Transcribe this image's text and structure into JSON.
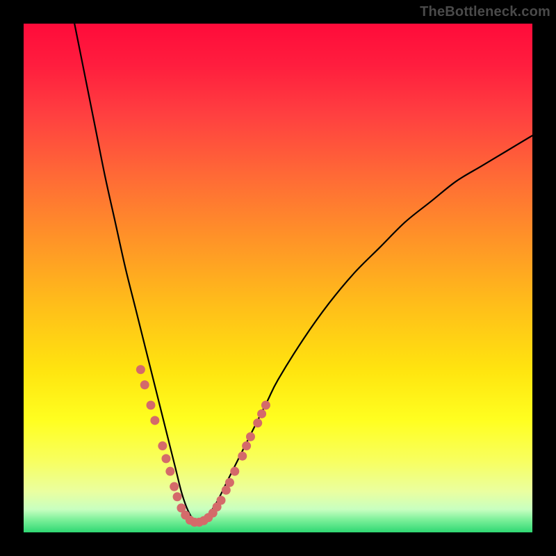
{
  "watermark": "TheBottleneck.com",
  "colors": {
    "frame": "#000000",
    "curve": "#000000",
    "marker": "#d46a6a",
    "bottom_band": "#2fd873",
    "grad_stops": [
      {
        "offset": 0.0,
        "color": "#ff0b3a"
      },
      {
        "offset": 0.08,
        "color": "#ff1d3e"
      },
      {
        "offset": 0.18,
        "color": "#ff4040"
      },
      {
        "offset": 0.3,
        "color": "#ff6a36"
      },
      {
        "offset": 0.42,
        "color": "#ff9228"
      },
      {
        "offset": 0.55,
        "color": "#ffbd1a"
      },
      {
        "offset": 0.68,
        "color": "#ffe40f"
      },
      {
        "offset": 0.78,
        "color": "#ffff20"
      },
      {
        "offset": 0.86,
        "color": "#f8ff60"
      },
      {
        "offset": 0.92,
        "color": "#eaffa0"
      },
      {
        "offset": 0.955,
        "color": "#c8ffc0"
      },
      {
        "offset": 0.975,
        "color": "#7df09a"
      },
      {
        "offset": 1.0,
        "color": "#2fd873"
      }
    ]
  },
  "chart_data": {
    "type": "line",
    "title": "",
    "xlabel": "",
    "ylabel": "",
    "xlim": [
      0,
      100
    ],
    "ylim": [
      0,
      100
    ],
    "grid": false,
    "legend": false,
    "series": [
      {
        "name": "bottleneck-curve",
        "x": [
          10,
          12,
          14,
          16,
          18,
          20,
          22,
          24,
          26,
          28,
          29,
          30,
          31,
          32,
          33,
          34,
          35,
          36,
          38,
          40,
          42,
          44,
          46,
          48,
          50,
          55,
          60,
          65,
          70,
          75,
          80,
          85,
          90,
          95,
          100
        ],
        "y": [
          100,
          90,
          80,
          70,
          61,
          52,
          44,
          36,
          28,
          20,
          16,
          12,
          8,
          5,
          3,
          2,
          2,
          3,
          6,
          10,
          14,
          18,
          22,
          26,
          30,
          38,
          45,
          51,
          56,
          61,
          65,
          69,
          72,
          75,
          78
        ]
      }
    ],
    "highlights": {
      "name": "marker-segments",
      "points": [
        {
          "x": 23.0,
          "y": 32.0
        },
        {
          "x": 23.8,
          "y": 29.0
        },
        {
          "x": 25.0,
          "y": 25.0
        },
        {
          "x": 25.8,
          "y": 22.0
        },
        {
          "x": 27.3,
          "y": 17.0
        },
        {
          "x": 28.0,
          "y": 14.5
        },
        {
          "x": 28.8,
          "y": 12.0
        },
        {
          "x": 29.6,
          "y": 9.0
        },
        {
          "x": 30.2,
          "y": 7.0
        },
        {
          "x": 31.0,
          "y": 4.8
        },
        {
          "x": 31.8,
          "y": 3.4
        },
        {
          "x": 32.7,
          "y": 2.4
        },
        {
          "x": 33.6,
          "y": 2.0
        },
        {
          "x": 34.5,
          "y": 2.0
        },
        {
          "x": 35.4,
          "y": 2.3
        },
        {
          "x": 36.3,
          "y": 2.9
        },
        {
          "x": 37.2,
          "y": 3.8
        },
        {
          "x": 38.0,
          "y": 5.0
        },
        {
          "x": 38.8,
          "y": 6.3
        },
        {
          "x": 39.8,
          "y": 8.3
        },
        {
          "x": 40.5,
          "y": 9.8
        },
        {
          "x": 41.5,
          "y": 12.0
        },
        {
          "x": 43.0,
          "y": 15.0
        },
        {
          "x": 43.8,
          "y": 17.0
        },
        {
          "x": 44.6,
          "y": 18.8
        },
        {
          "x": 46.0,
          "y": 21.5
        },
        {
          "x": 46.8,
          "y": 23.3
        },
        {
          "x": 47.6,
          "y": 25.0
        }
      ]
    }
  }
}
